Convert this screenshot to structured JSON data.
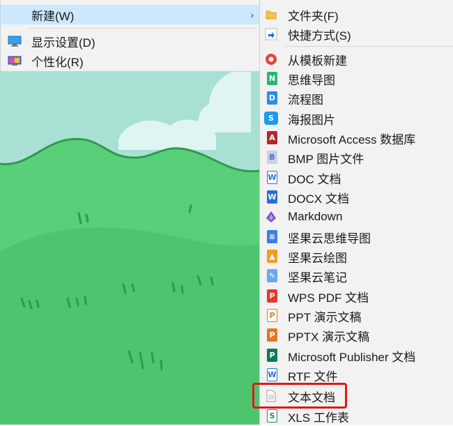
{
  "context_menu": {
    "new_label": "新建(W)",
    "display_label": "显示设置(D)",
    "personalize_label": "个性化(R)"
  },
  "submenu": {
    "items": [
      {
        "label": "文件夹(F)",
        "icon": "folder-icon"
      },
      {
        "label": "快捷方式(S)",
        "icon": "shortcut-icon"
      },
      {
        "label": "从模板新建",
        "icon": "template-icon"
      },
      {
        "label": "思维导图",
        "icon": "mindmap-icon"
      },
      {
        "label": "流程图",
        "icon": "flowchart-icon"
      },
      {
        "label": "海报图片",
        "icon": "poster-icon"
      },
      {
        "label": "Microsoft Access 数据库",
        "icon": "access-icon"
      },
      {
        "label": "BMP 图片文件",
        "icon": "bmp-icon"
      },
      {
        "label": "DOC 文档",
        "icon": "doc-icon"
      },
      {
        "label": "DOCX 文档",
        "icon": "docx-icon"
      },
      {
        "label": "Markdown",
        "icon": "markdown-icon"
      },
      {
        "label": "坚果云思维导图",
        "icon": "jianguo-mindmap-icon"
      },
      {
        "label": "坚果云绘图",
        "icon": "jianguo-drawing-icon"
      },
      {
        "label": "坚果云笔记",
        "icon": "jianguo-notes-icon"
      },
      {
        "label": "WPS PDF 文档",
        "icon": "wps-pdf-icon"
      },
      {
        "label": "PPT 演示文稿",
        "icon": "ppt-icon"
      },
      {
        "label": "PPTX 演示文稿",
        "icon": "pptx-icon"
      },
      {
        "label": "Microsoft Publisher 文档",
        "icon": "publisher-icon"
      },
      {
        "label": "RTF 文件",
        "icon": "rtf-icon"
      },
      {
        "label": "文本文档",
        "icon": "text-document-icon"
      },
      {
        "label": "XLS 工作表",
        "icon": "xls-icon"
      }
    ]
  },
  "colors": {
    "highlight": "#cce8ff",
    "annotation": "#e01818",
    "grass": "#5cd37e",
    "sky": "#a7e2d8"
  }
}
